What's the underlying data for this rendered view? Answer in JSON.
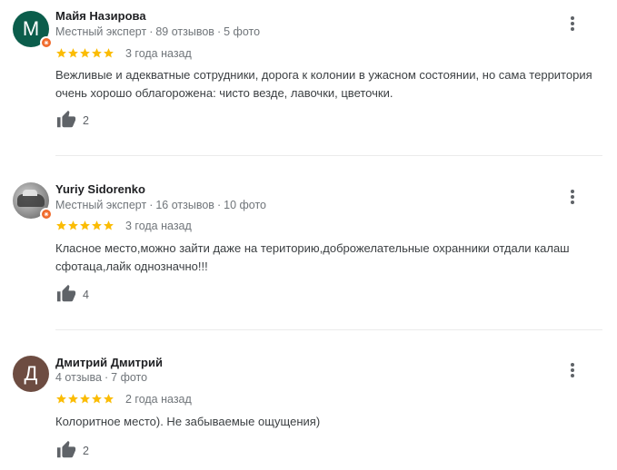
{
  "reviews": [
    {
      "author": "Майя Назирова",
      "avatar_letter": "М",
      "avatar_color": "#0b5d4b",
      "role": "Местный эксперт",
      "reviews_count": "89 отзывов",
      "photos_count": "5 фото",
      "rating": 5,
      "date": "3 года назад",
      "text": "Вежливые и адекватные сотрудники, дорога к колонии в ужасном состоянии, но сама территория очень хорошо облагорожена: чисто везде, лавочки, цветочки.",
      "likes": "2"
    },
    {
      "author": "Yuriy Sidorenko",
      "avatar_letter": "",
      "role": "Местный эксперт",
      "reviews_count": "16 отзывов",
      "photos_count": "10 фото",
      "rating": 5,
      "date": "3 года назад",
      "text": "Класное место,можно зайти даже на територию,доброжелательные охранники отдали калаш сфотаца,лайк однозначно!!!",
      "likes": "4"
    },
    {
      "author": "Дмитрий Дмитрий",
      "avatar_letter": "Д",
      "avatar_color": "#6d4c41",
      "reviews_count": "4 отзыва",
      "photos_count": "7 фото",
      "rating": 5,
      "date": "2 года назад",
      "text": "Колоритное место). Не забываемые ощущения)",
      "likes": "2"
    }
  ],
  "colors": {
    "star": "#fbbc04",
    "badge": "#f06a2b",
    "like_icon": "#5f6368"
  },
  "icons": {
    "like": "thumb-up-icon",
    "more": "more-vert-icon",
    "star": "star-icon",
    "badge": "local-guide-badge-icon"
  }
}
